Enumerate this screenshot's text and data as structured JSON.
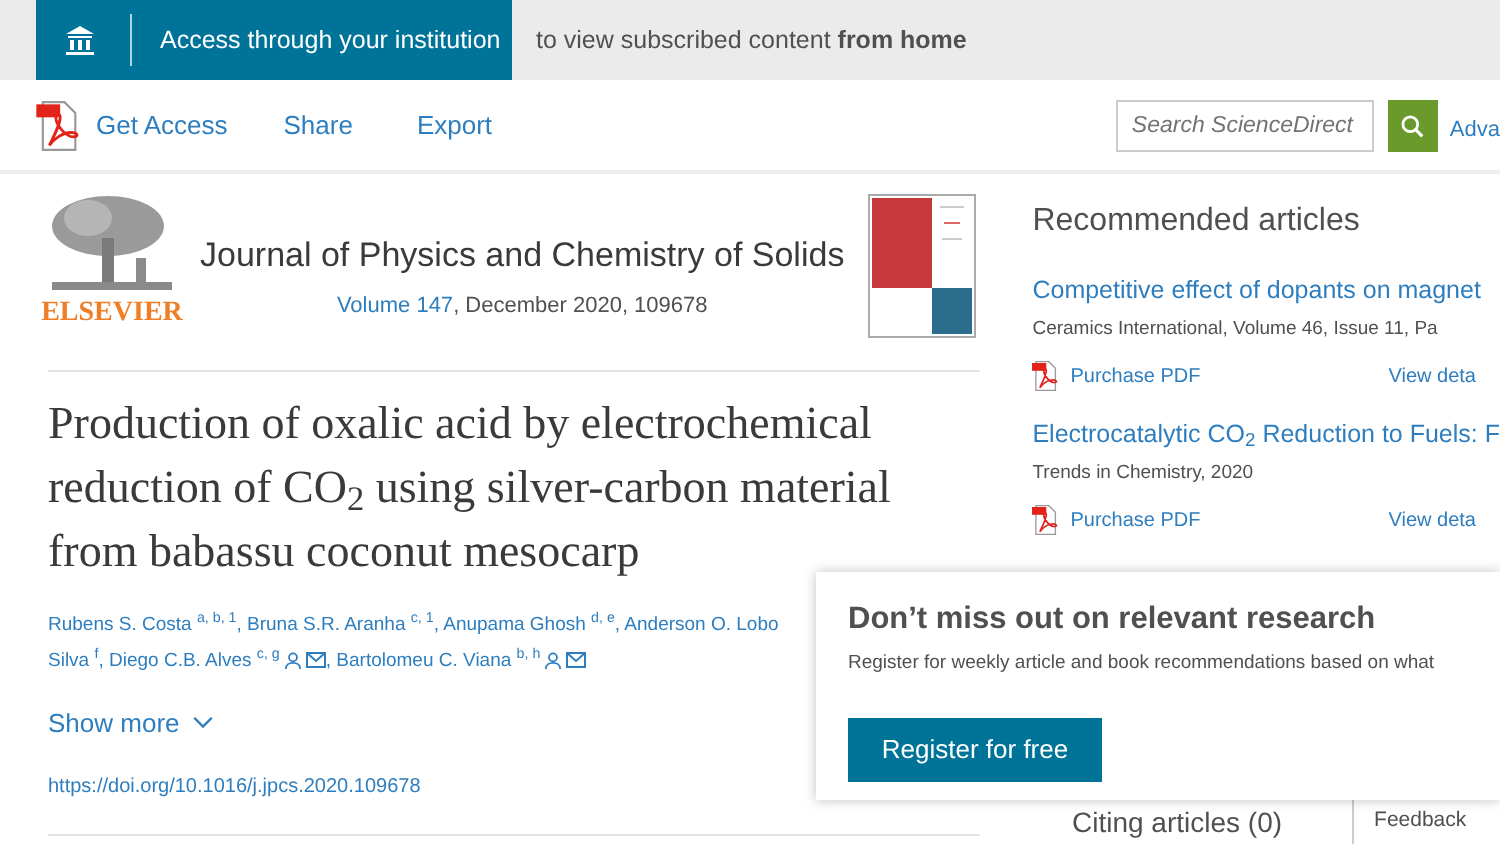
{
  "institution_banner": {
    "button": "Access through your institution",
    "message": "to view subscribed content **from home**"
  },
  "toolbar": {
    "items": [
      {
        "kind": "pdf",
        "label": "Get Access"
      },
      {
        "kind": "link",
        "label": "Share"
      },
      {
        "kind": "link",
        "label": "Export"
      }
    ],
    "search": {
      "placeholder": "Search ScienceDirect"
    },
    "advanced_link": "Adva"
  },
  "journal": {
    "publisher": "ELSEVIER",
    "name": "Journal of Physics and Chemistry of Solids",
    "volume_link": "Volume 147",
    "issue_info": ", December 2020, 109678"
  },
  "article": {
    "title": "Production of oxalic acid by electrochemical reduction of CO$_{2}$ using silver-carbon material from babassu coconut mesocarp",
    "authors": [
      {
        "name": "Rubens S. Costa $^{a, b, 1}$",
        "separator": ","
      },
      {
        "name": "Bruna S.R. Aranha $^{c, 1}$",
        "separator": ","
      },
      {
        "name": "Anupama Ghosh $^{d, e}$",
        "separator": ","
      },
      {
        "name": "Anderson O. Lobo"
      },
      {
        "name": "Silva $^{f}$",
        "separator": ","
      },
      {
        "name": "Diego C.B. Alves $^{c, g}$",
        "corresponding": true,
        "email": true,
        "separator": ","
      },
      {
        "name": "Bartolomeu C. Viana $^{b, h}$",
        "corresponding": true,
        "email": true
      }
    ],
    "show_more": "Show more",
    "doi": "https://doi.org/10.1016/j.jpcs.2020.109678"
  },
  "recommended": {
    "heading": "Recommended articles",
    "items": [
      {
        "title": "Competitive effect of dopants on magnet",
        "source": "Ceramics International, Volume 46, Issue 11, Pa",
        "purchase": "Purchase PDF",
        "details": "View deta"
      },
      {
        "title": "Electrocatalytic CO$_{2}$ Reduction to Fuels: F",
        "source": "Trends in Chemistry, 2020",
        "purchase": "Purchase PDF",
        "details": "View deta"
      }
    ]
  },
  "citing": {
    "heading": "Citing articles (0)"
  },
  "feedback": "Feedback",
  "register_popup": {
    "heading": "Don’t miss out on relevant research",
    "text": "Register for weekly article and book recommendations based on what",
    "button": "Register for free"
  }
}
